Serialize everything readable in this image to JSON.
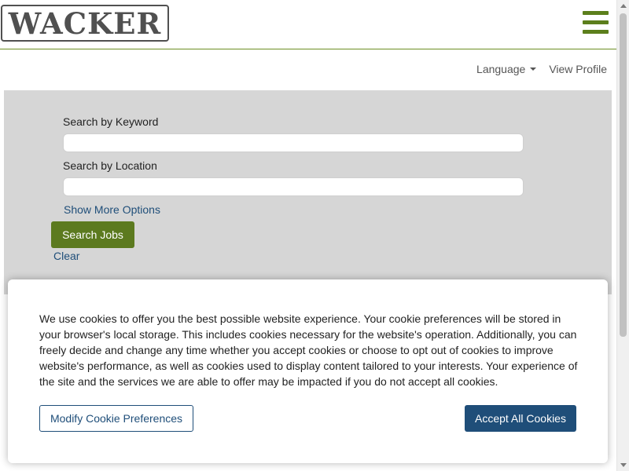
{
  "header": {
    "logo_text": "WACKER",
    "menu_icon": "hamburger-menu-icon"
  },
  "utility": {
    "language_label": "Language",
    "view_profile_label": "View Profile"
  },
  "search": {
    "keyword_label": "Search by Keyword",
    "keyword_value": "",
    "location_label": "Search by Location",
    "location_value": "",
    "more_options_label": "Show More Options",
    "search_button_label": "Search Jobs",
    "clear_label": "Clear"
  },
  "cookie_banner": {
    "text": "We use cookies to offer you the best possible website experience. Your cookie preferences will be stored in your browser's local storage. This includes cookies necessary for the website's operation. Additionally, you can freely decide and change any time whether you accept cookies or choose to opt out of cookies to improve website's performance, as well as cookies used to display content tailored to your interests. Your experience of the site and the services we are able to offer may be impacted if you do not accept all cookies.",
    "modify_label": "Modify Cookie Preferences",
    "accept_label": "Accept All Cookies"
  },
  "colors": {
    "brand_green": "#5c7a1f",
    "link_blue": "#1f4e79",
    "panel_gray": "#d6d6d6"
  }
}
